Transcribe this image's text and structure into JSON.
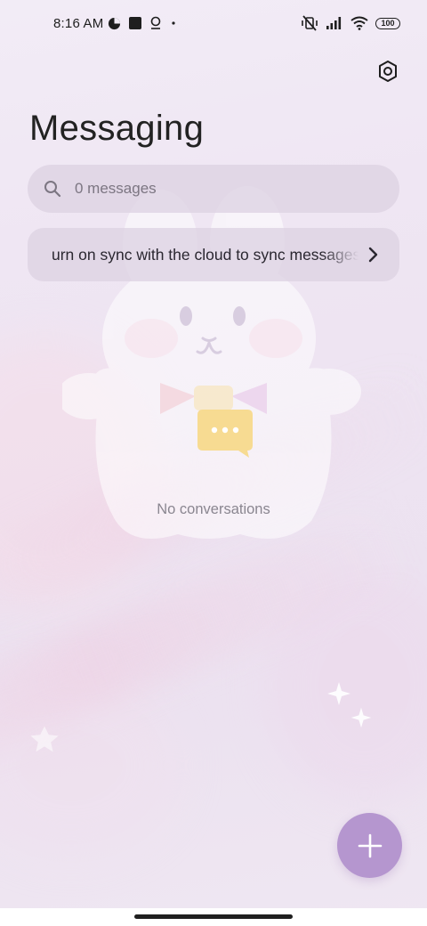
{
  "status_bar": {
    "time": "8:16 AM",
    "battery": "100",
    "left_icons": [
      "data-saver-icon",
      "square-notification-icon",
      "location-pin-icon",
      "dot-icon"
    ],
    "right_icons": [
      "vibrate-off-icon",
      "signal-icon",
      "wifi-icon",
      "battery-icon"
    ]
  },
  "header": {
    "title": "Messaging",
    "settings_icon": "settings-icon"
  },
  "search": {
    "placeholder": "0 messages",
    "icon": "search-icon"
  },
  "sync_banner": {
    "text": "urn on sync with the cloud to sync messages",
    "icon": "chevron-right-icon"
  },
  "empty_state": {
    "label": "No conversations",
    "icon": "chat-bubble-icon"
  },
  "fab": {
    "icon": "plus-icon",
    "color": "#b596cf"
  },
  "colors": {
    "accent": "#b596cf",
    "background": "#efe7f3",
    "empty_icon": "#f7d98c"
  }
}
